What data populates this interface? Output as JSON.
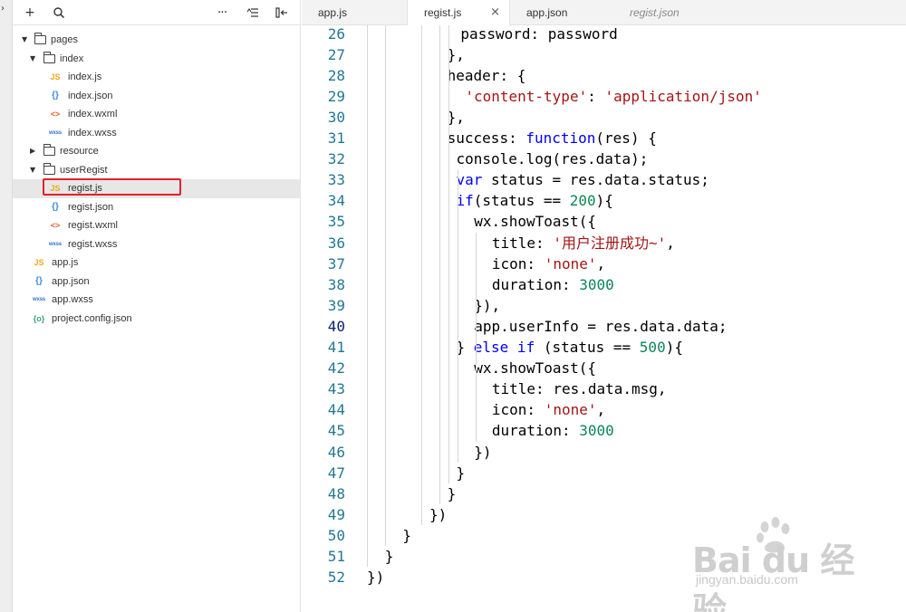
{
  "explorer": {
    "toolbar": {
      "add": "+",
      "search": "⌕",
      "more": "···",
      "sort": "≡",
      "collapse": "⇤"
    },
    "tree": [
      {
        "id": "pages",
        "label": "pages",
        "type": "folder",
        "expanded": true,
        "depth": 0
      },
      {
        "id": "index",
        "label": "index",
        "type": "folder",
        "expanded": true,
        "depth": 1
      },
      {
        "id": "index-js",
        "label": "index.js",
        "type": "js",
        "icon": "JS",
        "depth": 2
      },
      {
        "id": "index-json",
        "label": "index.json",
        "type": "json",
        "icon": "{}",
        "depth": 2
      },
      {
        "id": "index-wxml",
        "label": "index.wxml",
        "type": "wxml",
        "icon": "<>",
        "depth": 2
      },
      {
        "id": "index-wxss",
        "label": "index.wxss",
        "type": "wxss",
        "icon": "wxss",
        "depth": 2
      },
      {
        "id": "resource",
        "label": "resource",
        "type": "folder",
        "expanded": false,
        "depth": 1
      },
      {
        "id": "userRegist",
        "label": "userRegist",
        "type": "folder",
        "expanded": true,
        "depth": 1
      },
      {
        "id": "regist-js",
        "label": "regist.js",
        "type": "js",
        "icon": "JS",
        "depth": 2,
        "selected": true
      },
      {
        "id": "regist-json",
        "label": "regist.json",
        "type": "json",
        "icon": "{}",
        "depth": 2
      },
      {
        "id": "regist-wxml",
        "label": "regist.wxml",
        "type": "wxml",
        "icon": "<>",
        "depth": 2
      },
      {
        "id": "regist-wxss",
        "label": "regist.wxss",
        "type": "wxss",
        "icon": "wxss",
        "depth": 2
      },
      {
        "id": "app-js",
        "label": "app.js",
        "type": "js",
        "icon": "JS",
        "depth": 0
      },
      {
        "id": "app-json",
        "label": "app.json",
        "type": "json",
        "icon": "{}",
        "depth": 0
      },
      {
        "id": "app-wxss",
        "label": "app.wxss",
        "type": "wxss",
        "icon": "wxss",
        "depth": 0
      },
      {
        "id": "project-config",
        "label": "project.config.json",
        "type": "config",
        "icon": "{o}",
        "depth": 0
      }
    ]
  },
  "tabs": [
    {
      "label": "app.js",
      "active": false,
      "preview": false
    },
    {
      "label": "regist.js",
      "active": true,
      "preview": false,
      "close": "×"
    },
    {
      "label": "app.json",
      "active": false,
      "preview": false
    },
    {
      "label": "regist.json",
      "active": false,
      "preview": true
    }
  ],
  "editor": {
    "current_line": 40,
    "lines": [
      {
        "n": "26",
        "indent": 5.25,
        "tokens": [
          [
            "p",
            "password: password"
          ]
        ]
      },
      {
        "n": "27",
        "indent": 4.5,
        "tokens": [
          [
            "p",
            "},"
          ]
        ]
      },
      {
        "n": "28",
        "indent": 4.5,
        "tokens": [
          [
            "p",
            "header: {"
          ]
        ]
      },
      {
        "n": "29",
        "indent": 5.5,
        "tokens": [
          [
            "s",
            "'content-type'"
          ],
          [
            "p",
            ": "
          ],
          [
            "s",
            "'application/json'"
          ]
        ]
      },
      {
        "n": "30",
        "indent": 4.5,
        "tokens": [
          [
            "p",
            "},"
          ]
        ]
      },
      {
        "n": "31",
        "indent": 4.5,
        "tokens": [
          [
            "p",
            "success: "
          ],
          [
            "k",
            "function"
          ],
          [
            "p",
            "(res) {"
          ]
        ]
      },
      {
        "n": "32",
        "indent": 5,
        "tokens": [
          [
            "p",
            "console.log(res.data);"
          ]
        ]
      },
      {
        "n": "33",
        "indent": 5,
        "tokens": [
          [
            "k",
            "var"
          ],
          [
            "p",
            " status = res.data.status;"
          ]
        ]
      },
      {
        "n": "34",
        "indent": 5,
        "tokens": [
          [
            "k",
            "if"
          ],
          [
            "p",
            "(status == "
          ],
          [
            "n",
            "200"
          ],
          [
            "p",
            "){"
          ]
        ]
      },
      {
        "n": "35",
        "indent": 6,
        "tokens": [
          [
            "p",
            "wx.showToast({"
          ]
        ]
      },
      {
        "n": "36",
        "indent": 7,
        "tokens": [
          [
            "p",
            "title: "
          ],
          [
            "s",
            "'用户注册成功~'"
          ],
          [
            "p",
            ","
          ]
        ]
      },
      {
        "n": "37",
        "indent": 7,
        "tokens": [
          [
            "p",
            "icon: "
          ],
          [
            "s",
            "'none'"
          ],
          [
            "p",
            ","
          ]
        ]
      },
      {
        "n": "38",
        "indent": 7,
        "tokens": [
          [
            "p",
            "duration: "
          ],
          [
            "n",
            "3000"
          ]
        ]
      },
      {
        "n": "39",
        "indent": 6,
        "tokens": [
          [
            "p",
            "}),"
          ]
        ]
      },
      {
        "n": "40",
        "indent": 6,
        "tokens": [
          [
            "p",
            "app.userInfo = res.data.data;"
          ]
        ]
      },
      {
        "n": "41",
        "indent": 5,
        "tokens": [
          [
            "p",
            "} "
          ],
          [
            "k",
            "else if"
          ],
          [
            "p",
            " (status == "
          ],
          [
            "n",
            "500"
          ],
          [
            "p",
            "){"
          ]
        ]
      },
      {
        "n": "42",
        "indent": 6,
        "tokens": [
          [
            "p",
            "wx.showToast({"
          ]
        ]
      },
      {
        "n": "43",
        "indent": 7,
        "tokens": [
          [
            "p",
            "title: res.data.msg,"
          ]
        ]
      },
      {
        "n": "44",
        "indent": 7,
        "tokens": [
          [
            "p",
            "icon: "
          ],
          [
            "s",
            "'none'"
          ],
          [
            "p",
            ","
          ]
        ]
      },
      {
        "n": "45",
        "indent": 7,
        "tokens": [
          [
            "p",
            "duration: "
          ],
          [
            "n",
            "3000"
          ]
        ]
      },
      {
        "n": "46",
        "indent": 6,
        "tokens": [
          [
            "p",
            "})"
          ]
        ]
      },
      {
        "n": "47",
        "indent": 5,
        "tokens": [
          [
            "p",
            "}"
          ]
        ]
      },
      {
        "n": "48",
        "indent": 4.5,
        "tokens": [
          [
            "p",
            "}"
          ]
        ]
      },
      {
        "n": "49",
        "indent": 3.5,
        "tokens": [
          [
            "p",
            "})"
          ]
        ]
      },
      {
        "n": "50",
        "indent": 2,
        "tokens": [
          [
            "p",
            "}"
          ]
        ]
      },
      {
        "n": "51",
        "indent": 1,
        "tokens": [
          [
            "p",
            "}"
          ]
        ]
      },
      {
        "n": "52",
        "indent": 0,
        "tokens": [
          [
            "p",
            "})"
          ]
        ]
      }
    ]
  },
  "watermark": {
    "logo": "Bai du 经验",
    "url": "jingyan.baidu.com"
  },
  "colors": {
    "keyword": "#0000ff",
    "string": "#a31515",
    "number": "#098658",
    "line_number": "#237893",
    "current_line_number": "#0b216f",
    "highlight_box": "#e0232b",
    "selected_row": "#e7e7e7"
  }
}
